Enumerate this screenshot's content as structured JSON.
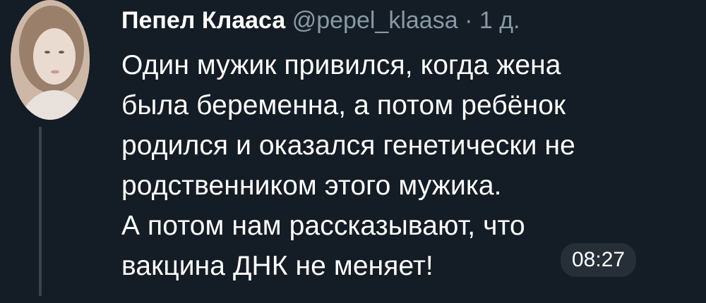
{
  "tweet": {
    "author_name": "Пепел Клааса",
    "handle": "@pepel_klaasa",
    "separator": "·",
    "time_ago": "1 д.",
    "lines": [
      "Один мужик привился, когда жена",
      "была беременна, а потом ребёнок",
      "родился и оказался генетически не",
      "родственником этого мужика.",
      "А потом нам рассказывают, что",
      "вакцина ДНК не меняет!"
    ]
  },
  "overlay": {
    "timestamp": "08:27"
  },
  "colors": {
    "background": "#141c25",
    "text": "#ffffff",
    "muted": "#8899a6",
    "thread_line": "#38444d"
  }
}
